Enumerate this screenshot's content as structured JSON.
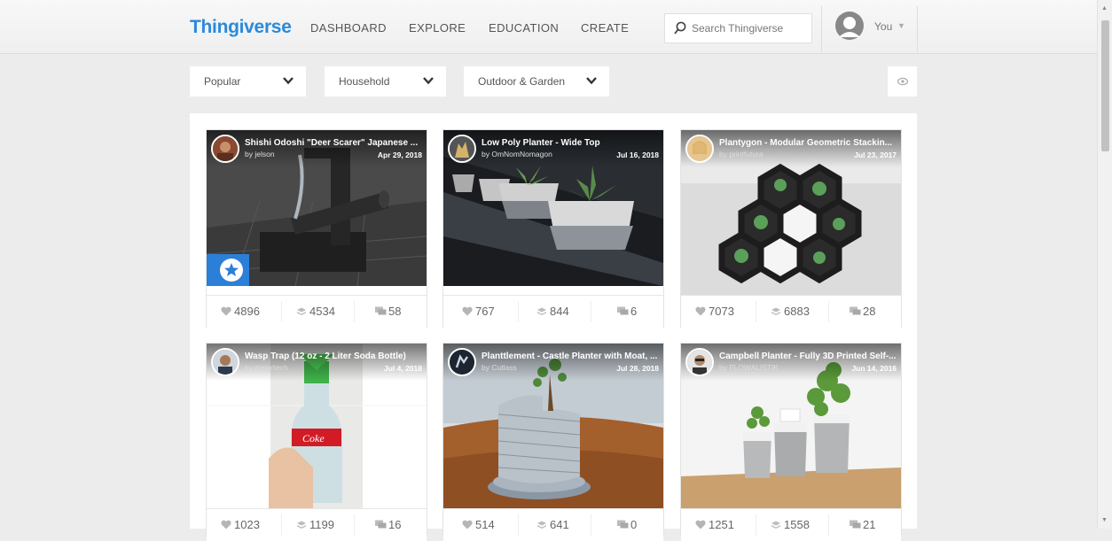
{
  "header": {
    "logo": "Thingiverse",
    "nav": [
      "DASHBOARD",
      "EXPLORE",
      "EDUCATION",
      "CREATE"
    ],
    "search_placeholder": "Search Thingiverse",
    "user_label": "You"
  },
  "filters": {
    "sort": "Popular",
    "category": "Household",
    "subcategory": "Outdoor & Garden"
  },
  "cards": [
    {
      "title": "Shishi Odoshi \"Deer Scarer\" Japanese ...",
      "author": "by jelson",
      "date": "Apr 29, 2018",
      "likes": "4896",
      "collects": "4534",
      "comments": "58",
      "featured": true
    },
    {
      "title": "Low Poly Planter - Wide Top",
      "author": "by OmNomNomagon",
      "date": "Jul 16, 2018",
      "likes": "767",
      "collects": "844",
      "comments": "6",
      "featured": false
    },
    {
      "title": "Plantygon - Modular Geometric Stackin...",
      "author": "by printfutura",
      "date": "Jul 23, 2017",
      "likes": "7073",
      "collects": "6883",
      "comments": "28",
      "featured": false
    },
    {
      "title": "Wasp Trap (12 oz - 2 Liter Soda Bottle)",
      "author": "by mstertech",
      "date": "Jul 4, 2018",
      "likes": "1023",
      "collects": "1199",
      "comments": "16",
      "featured": false
    },
    {
      "title": "Planttlement - Castle Planter with Moat, ...",
      "author": "by Cutlass",
      "date": "Jul 28, 2018",
      "likes": "514",
      "collects": "641",
      "comments": "0",
      "featured": false
    },
    {
      "title": "Campbell Planter - Fully 3D Printed Self-...",
      "author": "by FLOWALISTIK",
      "date": "Jun 14, 2016",
      "likes": "1251",
      "collects": "1558",
      "comments": "21",
      "featured": false
    }
  ],
  "thumbnail_labels": {
    "soda_label": "Coke"
  },
  "colors": {
    "brand": "#2a8ad9",
    "featured": "#2c7fd7"
  }
}
